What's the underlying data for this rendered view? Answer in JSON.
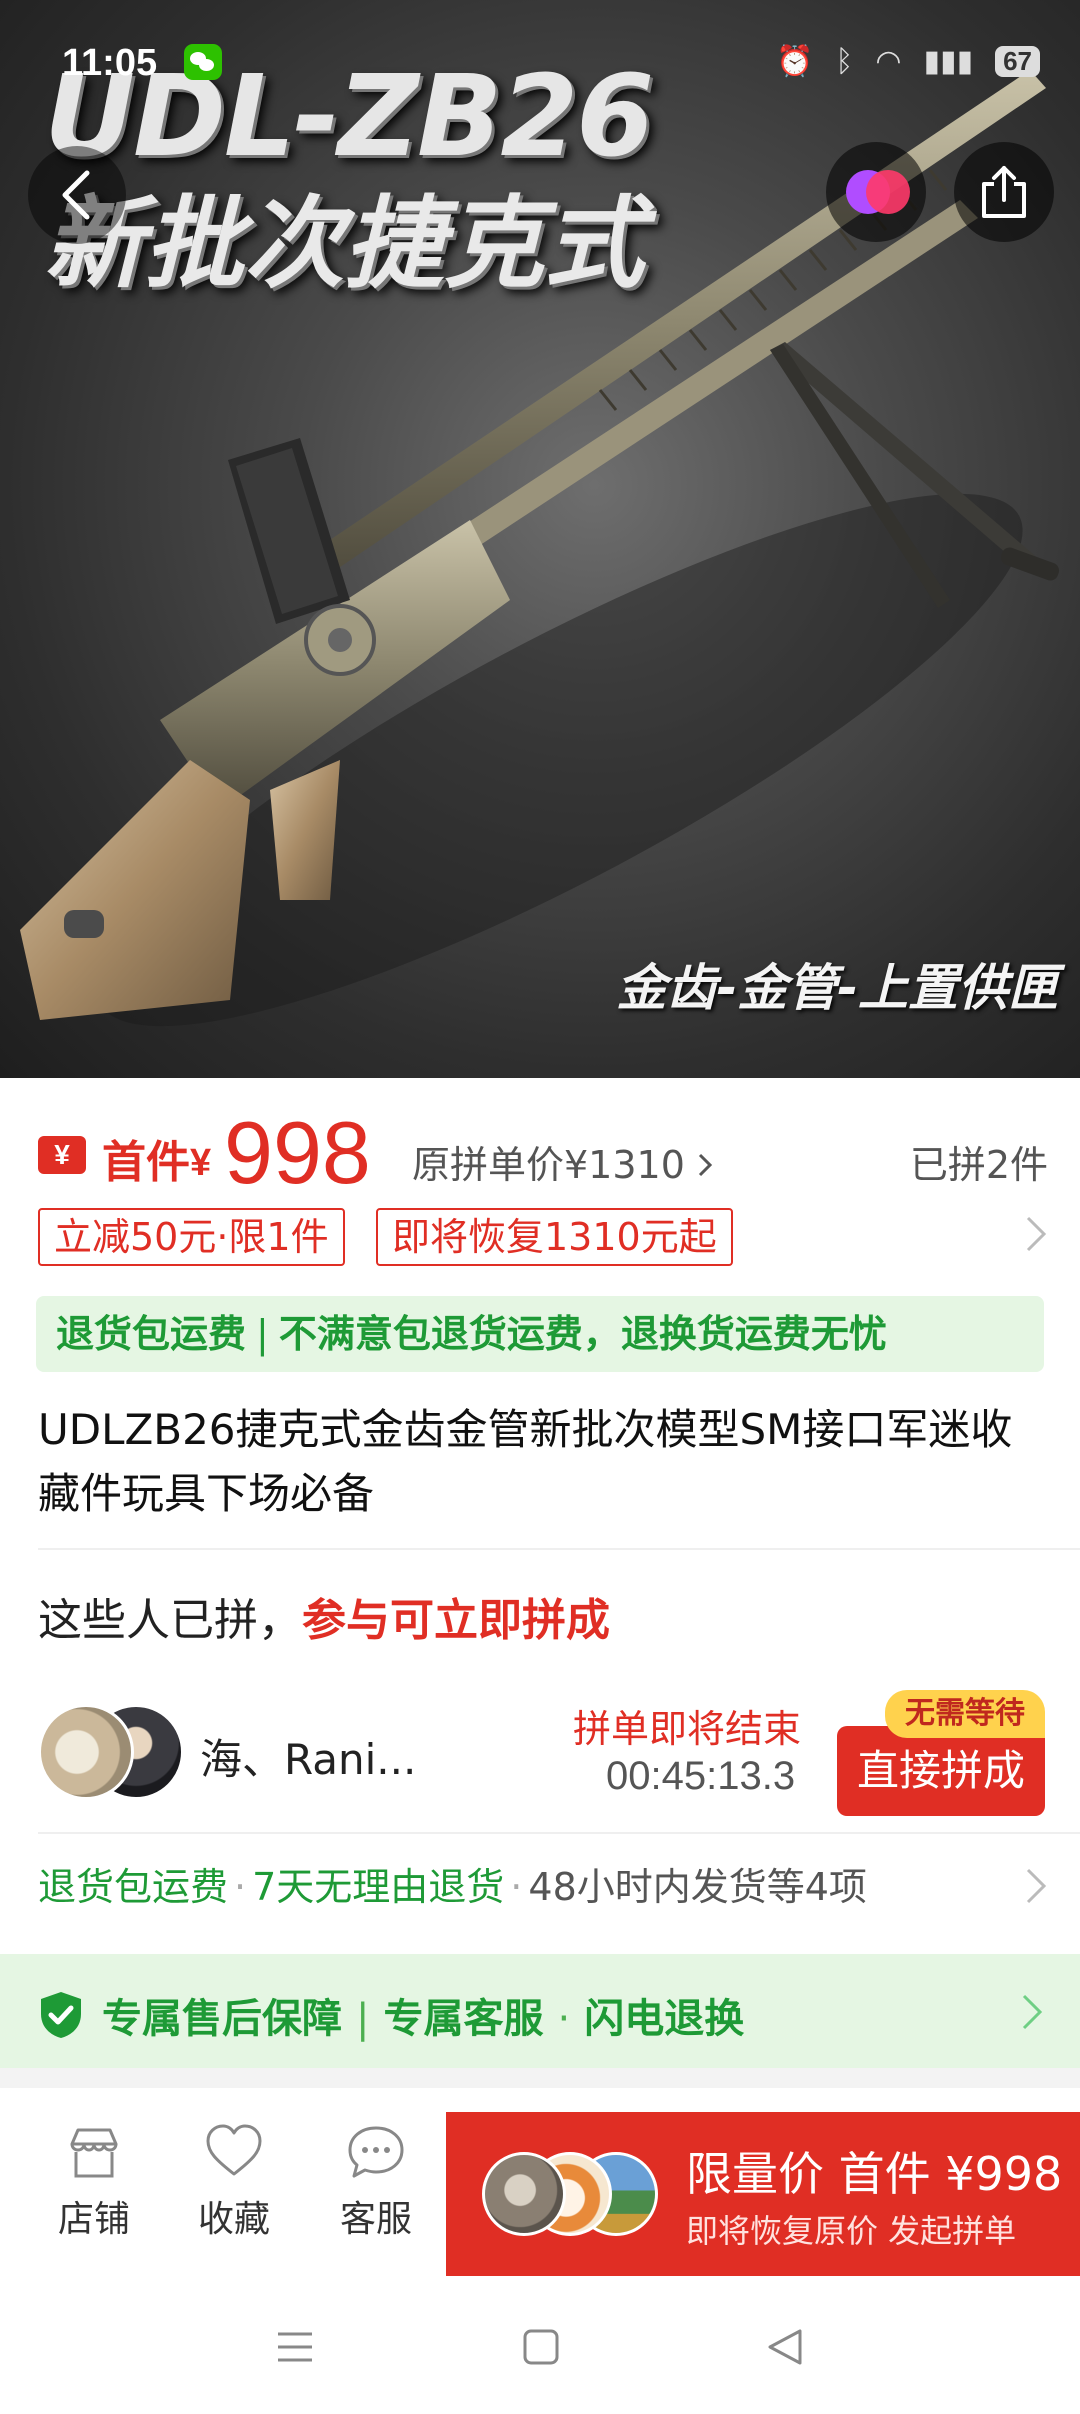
{
  "status_bar": {
    "time": "11:05",
    "battery": "67"
  },
  "hero": {
    "title": "UDL-ZB26",
    "subtitle": "新批次捷克式",
    "tagline": "金齿-金管-上置供匣"
  },
  "price": {
    "coupon_glyph": "¥",
    "first_label": "首件",
    "currency": "¥",
    "value": "998",
    "original_price": "原拼单价¥1310",
    "sold_count": "已拼2件"
  },
  "tags": [
    "立减50元·限1件",
    "即将恢复1310元起"
  ],
  "guarantee_banner": {
    "title": "退货包运费",
    "detail": "不满意包退货运费，退换货运费无忧"
  },
  "product_title": "UDLZB26捷克式金齿金管新批次模型SM接口军迷收藏件玩具下场必备",
  "group_buy": {
    "heading_prefix": "这些人已拼，",
    "heading_highlight": "参与可立即拼成",
    "member_name": "海、Rani...",
    "ending_label": "拼单即将结束",
    "countdown": "00:45:13.3",
    "join_label": "直接拼成",
    "no_wait_badge": "无需等待"
  },
  "services": {
    "item1": "退货包运费",
    "item2": "7天无理由退货",
    "item3": "48小时内发货等4项"
  },
  "after_sales": {
    "item1": "专属售后保障",
    "item2": "专属客服",
    "item3": "闪电退换"
  },
  "bottom_nav": {
    "store": "店铺",
    "favorite": "收藏",
    "service": "客服"
  },
  "buy_button": {
    "main": "限量价 首件 ¥998",
    "sub": "即将恢复原价 发起拼单"
  },
  "colors": {
    "accent_red": "#e02e24",
    "service_green": "#1e9a36",
    "green_background": "#e5f6e3",
    "badge_yellow": "#ffd24d"
  }
}
